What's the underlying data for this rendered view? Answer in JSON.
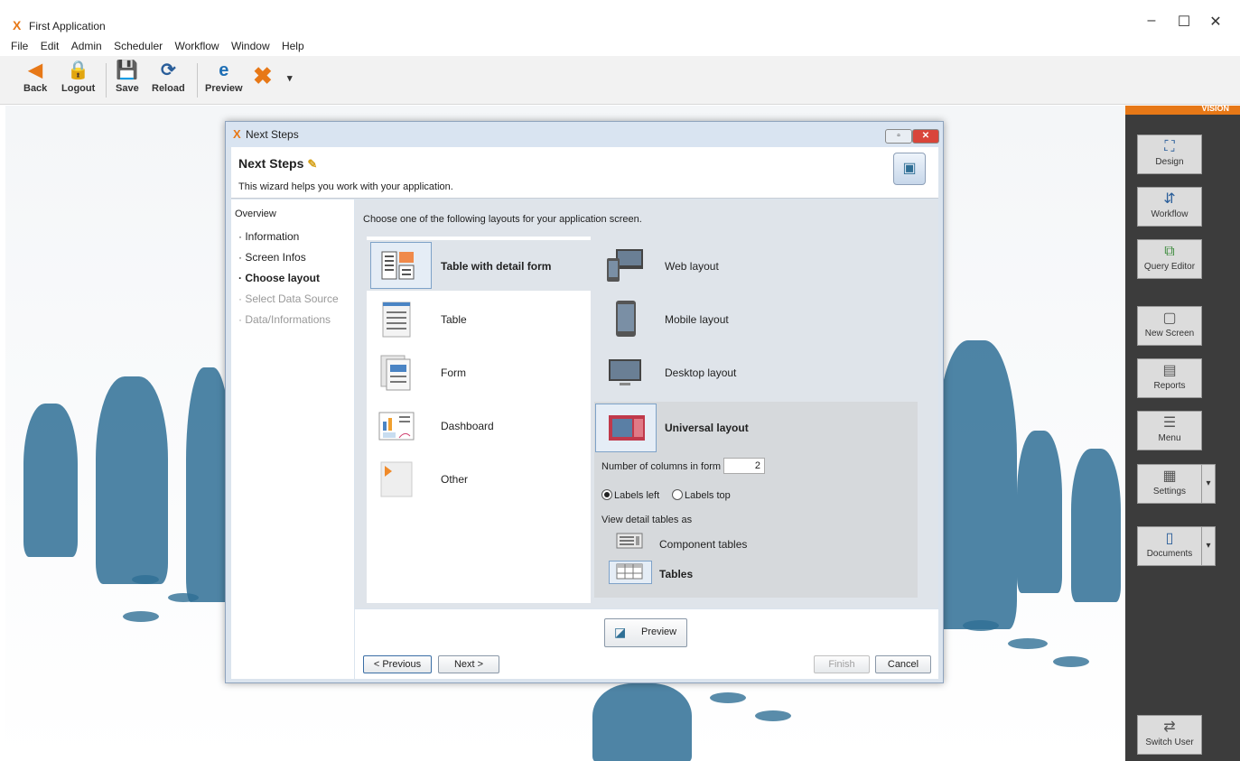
{
  "app": {
    "title": "First Application",
    "window_controls": {
      "minimize": "–",
      "maximize": "☐",
      "close": "✕"
    }
  },
  "menu": [
    "File",
    "Edit",
    "Admin",
    "Scheduler",
    "Workflow",
    "Window",
    "Help"
  ],
  "toolbar": {
    "back": "Back",
    "logout": "Logout",
    "save": "Save",
    "reload": "Reload",
    "preview": "Preview"
  },
  "vision_panel": {
    "brand": "VISION",
    "design": "Design",
    "workflow": "Workflow",
    "query_editor": "Query Editor",
    "new_screen": "New Screen",
    "reports": "Reports",
    "menu": "Menu",
    "settings": "Settings",
    "documents": "Documents",
    "switch_user": "Switch User"
  },
  "dialog": {
    "window_title": "Next Steps",
    "heading": "Next Steps",
    "subtitle": "This wizard helps you work with your application.",
    "nav": {
      "overview": "Overview",
      "items": [
        {
          "label": "· Information",
          "state": "done"
        },
        {
          "label": "· Screen Infos",
          "state": "done"
        },
        {
          "label": "· Choose layout",
          "state": "active"
        },
        {
          "label": "· Select Data Source",
          "state": "disabled"
        },
        {
          "label": "· Data/Informations",
          "state": "disabled"
        }
      ]
    },
    "prompt": "Choose one of the following layouts for your application screen.",
    "screen_layouts": [
      {
        "label": "Table with detail form",
        "selected": true
      },
      {
        "label": "Table",
        "selected": false
      },
      {
        "label": "Form",
        "selected": false
      },
      {
        "label": "Dashboard",
        "selected": false
      },
      {
        "label": "Other",
        "selected": false
      }
    ],
    "device_layouts": [
      {
        "label": "Web layout"
      },
      {
        "label": "Mobile layout"
      },
      {
        "label": "Desktop layout"
      }
    ],
    "universal": {
      "label": "Universal layout",
      "columns_label": "Number of columns in form",
      "columns_value": "2",
      "labels_left": "Labels left",
      "labels_top": "Labels top",
      "labels_selected": "left",
      "view_detail_label": "View detail tables as",
      "component_tables": "Component tables",
      "tables": "Tables",
      "tables_selected": "Tables"
    },
    "buttons": {
      "preview": "Preview",
      "previous": "< Previous",
      "next": "Next >",
      "finish": "Finish",
      "cancel": "Cancel"
    }
  }
}
